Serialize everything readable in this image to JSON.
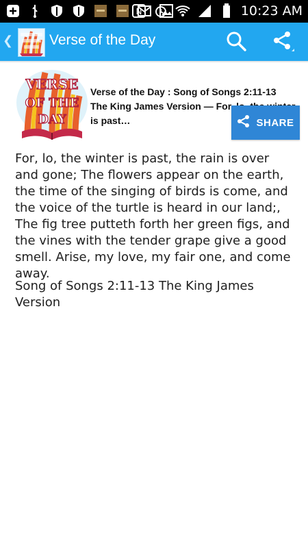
{
  "status_bar": {
    "time": "10:23 AM",
    "left_icons": [
      "add-icon",
      "usb-icon",
      "shield-icon",
      "shield-icon",
      "bible-app-icon",
      "bible-app-icon",
      "mail-icon",
      "photo-icon"
    ],
    "right_icons": [
      "nfc-icon",
      "alarm-icon",
      "wifi-icon",
      "signal-icon",
      "battery-icon"
    ]
  },
  "app_bar": {
    "title": "Verse of the Day",
    "bg_color": "#22a7f0"
  },
  "card": {
    "heading": "Verse of the Day : Song of Songs 2:11-13 The King James Version — For, lo, the winter is past…",
    "share_label": "SHARE",
    "share_color": "#2f86d6",
    "image_words": [
      "VERSE",
      "OF THE",
      "DAY"
    ]
  },
  "verse_text": "For, lo, the winter is past, the rain is over and gone; The flowers appear on the earth, the time of the singing of birds is come, and the voice of the turtle is heard in our land;, The fig tree putteth forth her green figs, and the vines with the tender grape give a good smell. Arise, my love, my fair one, and come away.",
  "reference": "Song of Songs 2:11-13  The King James Version"
}
